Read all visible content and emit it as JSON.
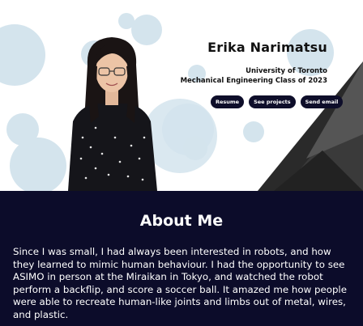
{
  "header": {
    "name": "Erika Narimatsu",
    "school": "University of Toronto",
    "program": "Mechanical Engineering Class of 2023"
  },
  "buttons": {
    "resume": "Resume",
    "projects": "See projects",
    "email": "Send email"
  },
  "about": {
    "title": "About Me",
    "body": "Since I was small, I had always been interested in robots, and how they learned to mimic human behaviour. I had the opportunity to see ASIMO in person at the Miraikan in Tokyo, and watched the robot perform a backflip, and score a soccer ball. It amazed me how people were able to recreate human-like joints and limbs out of metal, wires, and plastic."
  },
  "colors": {
    "navy": "#0c0c2a",
    "bubble": "#d4e4ed"
  }
}
